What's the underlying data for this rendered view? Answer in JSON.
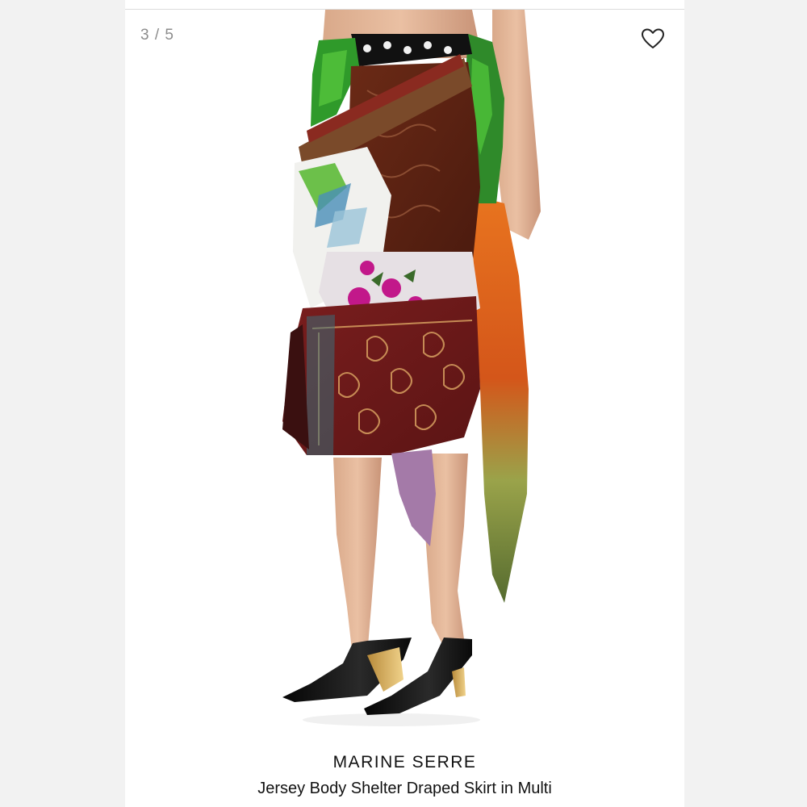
{
  "gallery": {
    "counter": "3 / 5",
    "favorite_icon": "heart-outline-icon"
  },
  "product": {
    "brand": "MARINE SERRE",
    "name": "Jersey Body Shelter Draped Skirt in Multi",
    "image_alt": "Model wearing multicolor patchwork draped midi skirt with black pointed mules"
  },
  "colors": {
    "background": "#f2f2f2",
    "card": "#ffffff",
    "text": "#111111",
    "counter": "#8c8c8c"
  }
}
